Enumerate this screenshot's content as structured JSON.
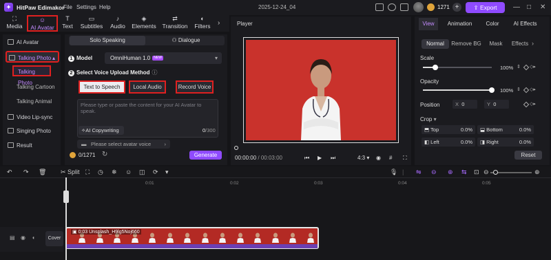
{
  "app": {
    "name": "HitPaw Edimakor",
    "menu": [
      "File",
      "Settings",
      "Help"
    ],
    "doc_title": "2025-12-24_04",
    "credits": "1271",
    "export_label": "Export"
  },
  "toolbar": {
    "tools": [
      {
        "label": "Media",
        "icon": "media-icon"
      },
      {
        "label": "AI Avatar",
        "icon": "ai-avatar-icon",
        "selected": true
      },
      {
        "label": "Text",
        "icon": "text-icon"
      },
      {
        "label": "Subtitles",
        "icon": "subtitles-icon"
      },
      {
        "label": "Audio",
        "icon": "audio-icon"
      },
      {
        "label": "Elements",
        "icon": "elements-icon"
      },
      {
        "label": "Transition",
        "icon": "transition-icon"
      },
      {
        "label": "Filters",
        "icon": "filters-icon"
      }
    ]
  },
  "sidebar": {
    "items": [
      {
        "label": "AI Avatar"
      },
      {
        "label": "Talking Photo"
      },
      {
        "label": "Video Lip-sync"
      },
      {
        "label": "Singing Photo"
      },
      {
        "label": "Result"
      }
    ],
    "sub_items": [
      "Talking Photo",
      "Talking Cartoon",
      "Talking Animal"
    ]
  },
  "mid": {
    "tabs": [
      "Solo Speaking",
      "Dialogue"
    ],
    "model_label": "Model",
    "model_value": "OmniHuman 1.0",
    "model_badge": "NEW",
    "voice_label": "Select Voice Upload Method",
    "options": [
      "Text to Speech",
      "Local Audio",
      "Record Voice"
    ],
    "placeholder": "Please type or paste the content for your AI Avatar to speak.",
    "ai_copy": "AI Copywriting",
    "char_count": "0",
    "char_max": "/300",
    "select_voice": "Please select avatar voice",
    "credits_text": "0/1271",
    "generate": "Generate"
  },
  "player": {
    "title": "Player",
    "time_current": "00:00:00",
    "time_total": "/ 00:03:00",
    "ratio": "4:3"
  },
  "right": {
    "tabs": [
      "View",
      "Animation",
      "Color",
      "AI Effects"
    ],
    "subtabs": [
      "Normal",
      "Remove BG",
      "Mask",
      "Effects"
    ],
    "scale_label": "Scale",
    "scale_value": "100%",
    "scale_level": 1.0,
    "opacity_label": "Opacity",
    "opacity_value": "100%",
    "opacity_level": 1.0,
    "position_label": "Position",
    "pos_x_label": "X",
    "pos_x": "0",
    "pos_y_label": "Y",
    "pos_y": "0",
    "crop_label": "Crop",
    "crop_top_label": "Top",
    "crop_top": "0.0%",
    "crop_bottom_label": "Bottom",
    "crop_bottom": "0.0%",
    "crop_left_label": "Left",
    "crop_left": "0.0%",
    "crop_right_label": "Right",
    "crop_right": "0.0%",
    "reset": "Reset"
  },
  "timeline": {
    "split_label": "Split",
    "ruler_labels": [
      "0:01",
      "0:02",
      "0:03",
      "0:04",
      "0:05"
    ],
    "cover_label": "Cover",
    "clip_label": "0:03 Unsplash_H9lg5Noj660"
  },
  "colors": {
    "accent": "#8f4bff",
    "highlight": "#e02020",
    "video_bg": "#c9322c"
  }
}
